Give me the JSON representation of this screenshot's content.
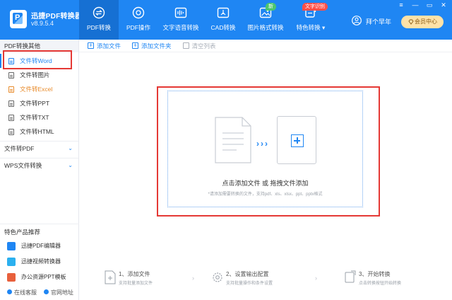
{
  "app": {
    "name": "迅捷PDF转换器",
    "version": "v8.9.5.4"
  },
  "nav": [
    {
      "label": "PDF转换",
      "icon": "swap-icon",
      "active": true
    },
    {
      "label": "PDF操作",
      "icon": "pdf-tool-icon"
    },
    {
      "label": "文字语音转换",
      "icon": "audio-wave-icon"
    },
    {
      "label": "CAD转换",
      "icon": "cad-icon"
    },
    {
      "label": "图片格式转换",
      "icon": "image-icon",
      "badge": "新"
    },
    {
      "label": "特色转换",
      "icon": "special-icon",
      "badge": "文字识别"
    }
  ],
  "user": {
    "name": "拜个早年",
    "vip_label": "会员中心"
  },
  "window": {
    "menu": "≡",
    "minimize": "—",
    "restore": "▭",
    "close": "✕"
  },
  "sidebar": {
    "group1": "PDF转换其他",
    "items": [
      "文件转Word",
      "文件转图片",
      "文件转Excel",
      "文件转PPT",
      "文件转TXT",
      "文件转HTML"
    ],
    "group2": "文件转PDF",
    "group3": "WPS文件转换",
    "chevron": "⌄",
    "rec_title": "特色产品推荐",
    "rec_items": [
      "迅捷PDF编辑器",
      "迅捷视频转换器",
      "办公资源PPT模板"
    ],
    "bottom": [
      "在线客服",
      "官网地址"
    ]
  },
  "toolbar": {
    "add_file": "添加文件",
    "add_folder": "添加文件夹",
    "clear_list": "清空列表"
  },
  "dropzone": {
    "arrows": "›››",
    "main_text": "点击添加文件 或 拖拽文件添加",
    "sub_text": "*请添加需要转换的文件，支持pdf、xls、xlsx、ppt、pptx格式"
  },
  "steps": [
    {
      "title": "1、添加文件",
      "desc": "支持批量添加文件"
    },
    {
      "title": "2、设置输出配置",
      "desc": "支持批量操作和条件设置"
    },
    {
      "title": "3、开始转换",
      "desc": "点击转换按钮开始转换"
    }
  ],
  "step_arrow": "›",
  "colors": {
    "brand": "#1f86f3",
    "highlight_border": "#e53935",
    "excel_item": "#e88b2b"
  }
}
